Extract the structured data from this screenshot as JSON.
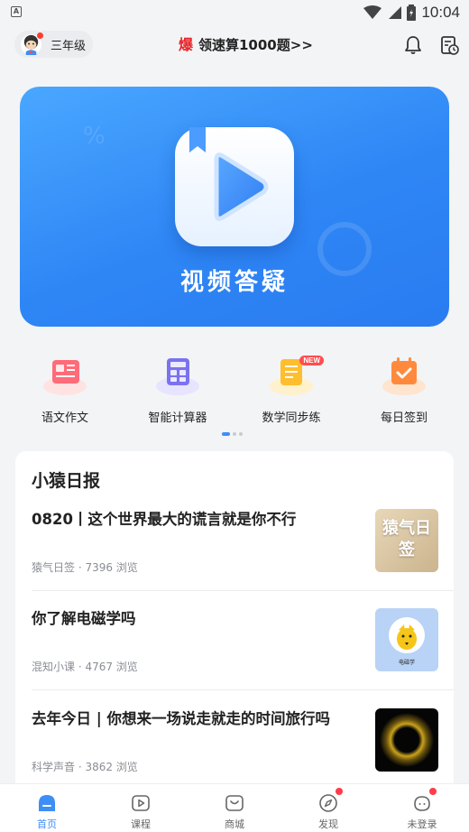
{
  "status_bar": {
    "time": "10:04",
    "app_badge": "A"
  },
  "header": {
    "grade_label": "三年级",
    "promo_icon_char": "爆",
    "promo_text": "领速算1000题>>"
  },
  "banner": {
    "title": "视频答疑"
  },
  "tools": [
    {
      "label": "语文作文",
      "icon": "composition-icon",
      "color": "#ff6b6b"
    },
    {
      "label": "智能计算器",
      "icon": "calculator-icon",
      "color": "#7b6ff5"
    },
    {
      "label": "数学同步练",
      "icon": "math-practice-icon",
      "color": "#ffb020",
      "badge": "NEW"
    },
    {
      "label": "每日签到",
      "icon": "calendar-checkin-icon",
      "color": "#ff8a3d"
    }
  ],
  "pager": {
    "pages": 3,
    "active": 0
  },
  "news": {
    "title": "小猿日报",
    "articles": [
      {
        "title": "0820丨这个世界最大的谎言就是你不行",
        "meta": "猿气日签 · 7396 浏览",
        "thumb_text": "猿气日签"
      },
      {
        "title": "你了解电磁学吗",
        "meta": "混知小课 · 4767 浏览",
        "thumb_text": "电磁学"
      },
      {
        "title": "去年今日 | 你想来一场说走就走的时间旅行吗",
        "meta": "科学声音 · 3862 浏览",
        "thumb_text": ""
      }
    ]
  },
  "bottom_nav": [
    {
      "label": "首页",
      "active": true
    },
    {
      "label": "课程",
      "active": false
    },
    {
      "label": "商城",
      "active": false
    },
    {
      "label": "发现",
      "active": false,
      "dot": true
    },
    {
      "label": "未登录",
      "active": false,
      "dot": true
    }
  ],
  "colors": {
    "accent": "#3e8ef7",
    "badge_red": "#ff3b30"
  }
}
